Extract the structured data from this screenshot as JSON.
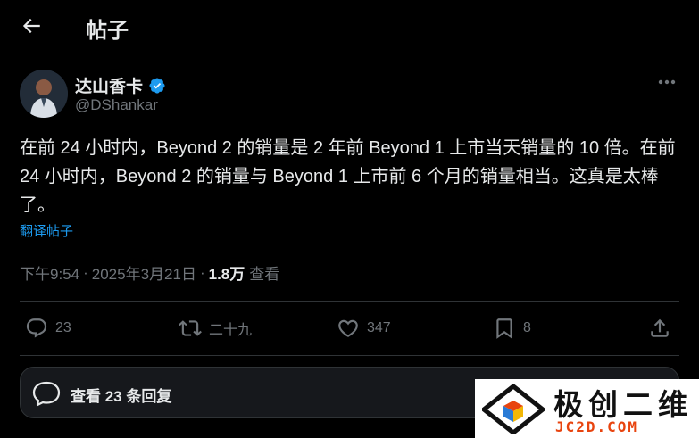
{
  "header": {
    "title": "帖子",
    "back_icon": "arrow-left-icon"
  },
  "author": {
    "display_name": "达山香卡",
    "handle": "@DShankar",
    "verified": true,
    "verified_color": "#1d9bf0"
  },
  "post": {
    "text": "在前 24 小时内，Beyond 2 的销量是 2 年前 Beyond 1 上市当天销量的 10 倍。在前 24 小时内，Beyond 2 的销量与 Beyond 1 上市前 6 个月的销量相当。这真是太棒了。",
    "translate_label": "翻译帖子"
  },
  "meta": {
    "time": "下午9:54",
    "separator": "·",
    "date": "2025年3月21日",
    "views_count": "1.8万",
    "views_label": "查看"
  },
  "actions": {
    "reply": {
      "icon": "reply-icon",
      "count": "23"
    },
    "repost": {
      "icon": "repost-icon",
      "count": "二十九"
    },
    "like": {
      "icon": "heart-icon",
      "count": "347"
    },
    "bookmark": {
      "icon": "bookmark-icon",
      "count": "8"
    },
    "share": {
      "icon": "share-icon"
    }
  },
  "replies": {
    "label": "查看 23 条回复",
    "icon": "speech-bubble-icon"
  },
  "watermark": {
    "title": "极创二维",
    "domain": "JC2D.COM"
  },
  "colors": {
    "background": "#000000",
    "text": "#e7e9ea",
    "muted": "#71767b",
    "accent": "#1d9bf0",
    "border": "#2f3336"
  }
}
